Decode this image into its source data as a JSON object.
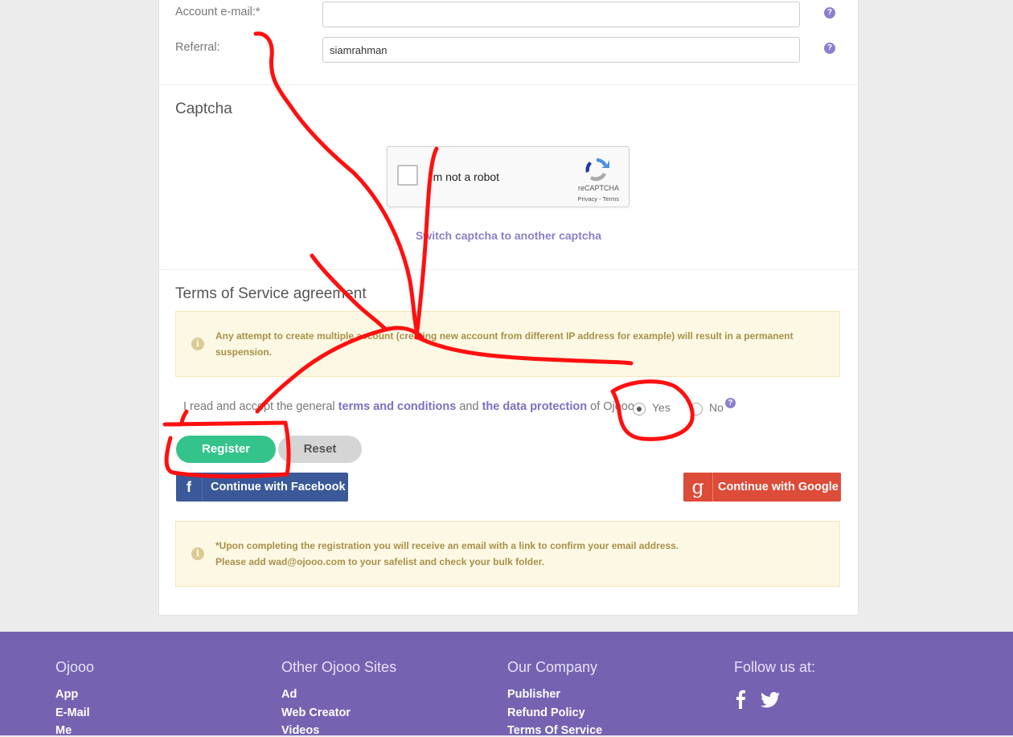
{
  "form": {
    "email_label": "Account e-mail:*",
    "email_value": "",
    "referral_label": "Referral:",
    "referral_value": "siamrahman",
    "help_glyph": "?"
  },
  "captcha": {
    "title": "Captcha",
    "checkbox_label": "I'm not a robot",
    "brand": "reCAPTCHA",
    "links": "Privacy - Terms",
    "switch_link": "Switch captcha to another captcha"
  },
  "terms": {
    "title": "Terms of Service agreement",
    "warning": "Any attempt to create multiple account (creating new account from different IP address for example) will result in a permanent suspension.",
    "agree_prefix": "I read and accept the general",
    "terms_link": "terms and conditions",
    "and": "and",
    "data_link": "the data protection",
    "agree_suffix": "of Ojooo.",
    "yes": "Yes",
    "no": "No",
    "selected": "Yes"
  },
  "actions": {
    "register": "Register",
    "reset": "Reset",
    "facebook": "Continue with Facebook",
    "google": "Continue with Google",
    "facebook_glyph": "f",
    "google_glyph": "g"
  },
  "notice": {
    "line1": "*Upon completing the registration you will receive an email with a link to confirm your email address.",
    "line2": "Please add wad@ojooo.com to your safelist and check your bulk folder."
  },
  "footer": {
    "columns": [
      {
        "heading": "Ojooo",
        "links": [
          "App",
          "E-Mail",
          "Me"
        ]
      },
      {
        "heading": "Other Ojooo Sites",
        "links": [
          "Ad",
          "Web Creator",
          "Videos"
        ]
      },
      {
        "heading": "Our Company",
        "links": [
          "Publisher",
          "Refund Policy",
          "Terms Of Service"
        ]
      },
      {
        "heading": "Follow us at:",
        "links": []
      }
    ],
    "social_icons": [
      "facebook-icon",
      "twitter-icon"
    ]
  },
  "colors": {
    "accent": "#7563b2",
    "register": "#34c48b",
    "facebook": "#3b5998",
    "google": "#dd4b39",
    "alert_bg": "#fcf8e3",
    "annotation": "#ff0000"
  }
}
